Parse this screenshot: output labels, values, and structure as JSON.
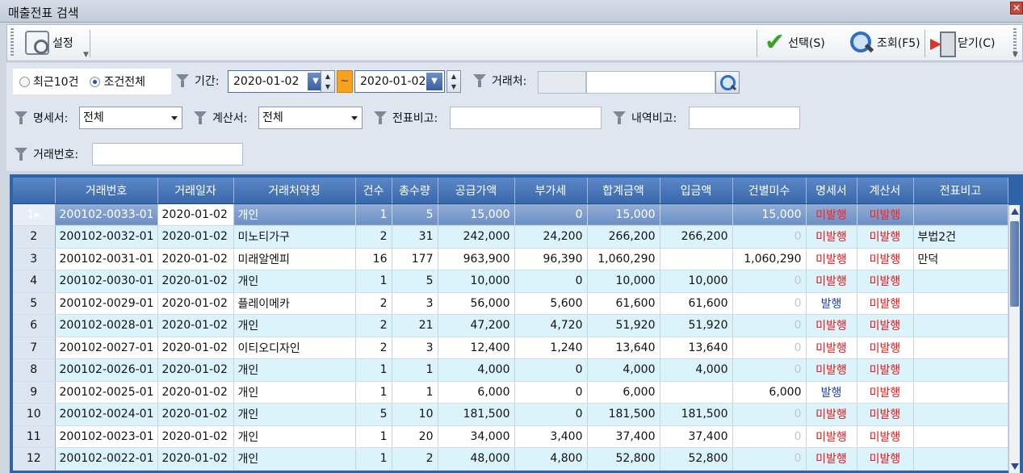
{
  "window": {
    "title": "매출전표 검색",
    "close_glyph": "✕"
  },
  "toolbar": {
    "settings_label": "설정",
    "select_label": "선택(S)",
    "query_label": "조회(F5)",
    "close_label": "닫기(C)"
  },
  "filter": {
    "radio_recent": "최근10건",
    "radio_all": "조건전체",
    "selected_radio": "조건전체",
    "period_label": "기간:",
    "date_from": "2020-01-02",
    "date_to": "2020-01-02",
    "range_sep": "~",
    "client_label": "거래처:",
    "client_code": "",
    "client_name": "",
    "statement_label": "명세서:",
    "statement_value": "전체",
    "invoice_label": "계산서:",
    "invoice_value": "전체",
    "slip_note_label": "전표비고:",
    "slip_note_value": "",
    "detail_note_label": "내역비고:",
    "detail_note_value": "",
    "trade_no_label": "거래번호:",
    "trade_no_value": ""
  },
  "grid": {
    "columns": [
      "거래번호",
      "거래일자",
      "거래처약칭",
      "건수",
      "총수량",
      "공급가액",
      "부가세",
      "합계금액",
      "입금액",
      "건별미수",
      "명세서",
      "계산서",
      "전표비고"
    ],
    "selected_row": 1,
    "rows": [
      {
        "n": "1",
        "marker": "▸",
        "no": "200102-0033-01",
        "date": "2020-01-02",
        "client": "개인",
        "cnt": "1",
        "qty": "5",
        "supply": "15,000",
        "vat": "0",
        "total": "15,000",
        "paid": "",
        "due": "15,000",
        "stmt": "미발행",
        "inv": "미발행",
        "note": ""
      },
      {
        "n": "2",
        "marker": "",
        "no": "200102-0032-01",
        "date": "2020-01-02",
        "client": "미노티가구",
        "cnt": "2",
        "qty": "31",
        "supply": "242,000",
        "vat": "24,200",
        "total": "266,200",
        "paid": "266,200",
        "due": "0",
        "stmt": "미발행",
        "inv": "미발행",
        "note": "부법2건"
      },
      {
        "n": "3",
        "marker": "",
        "no": "200102-0031-01",
        "date": "2020-01-02",
        "client": "미래알엔피",
        "cnt": "16",
        "qty": "177",
        "supply": "963,900",
        "vat": "96,390",
        "total": "1,060,290",
        "paid": "",
        "due": "1,060,290",
        "stmt": "미발행",
        "inv": "미발행",
        "note": "만덕"
      },
      {
        "n": "4",
        "marker": "",
        "no": "200102-0030-01",
        "date": "2020-01-02",
        "client": "개인",
        "cnt": "1",
        "qty": "5",
        "supply": "10,000",
        "vat": "0",
        "total": "10,000",
        "paid": "10,000",
        "due": "0",
        "stmt": "미발행",
        "inv": "미발행",
        "note": ""
      },
      {
        "n": "5",
        "marker": "",
        "no": "200102-0029-01",
        "date": "2020-01-02",
        "client": "플레이메카",
        "cnt": "2",
        "qty": "3",
        "supply": "56,000",
        "vat": "5,600",
        "total": "61,600",
        "paid": "61,600",
        "due": "0",
        "stmt": "발행",
        "inv": "미발행",
        "note": ""
      },
      {
        "n": "6",
        "marker": "",
        "no": "200102-0028-01",
        "date": "2020-01-02",
        "client": "개인",
        "cnt": "2",
        "qty": "21",
        "supply": "47,200",
        "vat": "4,720",
        "total": "51,920",
        "paid": "51,920",
        "due": "0",
        "stmt": "미발행",
        "inv": "미발행",
        "note": ""
      },
      {
        "n": "7",
        "marker": "",
        "no": "200102-0027-01",
        "date": "2020-01-02",
        "client": "이티오디자인",
        "cnt": "2",
        "qty": "3",
        "supply": "12,400",
        "vat": "1,240",
        "total": "13,640",
        "paid": "13,640",
        "due": "0",
        "stmt": "미발행",
        "inv": "미발행",
        "note": ""
      },
      {
        "n": "8",
        "marker": "",
        "no": "200102-0026-01",
        "date": "2020-01-02",
        "client": "개인",
        "cnt": "1",
        "qty": "1",
        "supply": "4,000",
        "vat": "0",
        "total": "4,000",
        "paid": "4,000",
        "due": "0",
        "stmt": "미발행",
        "inv": "미발행",
        "note": ""
      },
      {
        "n": "9",
        "marker": "",
        "no": "200102-0025-01",
        "date": "2020-01-02",
        "client": "개인",
        "cnt": "1",
        "qty": "1",
        "supply": "6,000",
        "vat": "0",
        "total": "6,000",
        "paid": "",
        "due": "6,000",
        "stmt": "발행",
        "inv": "미발행",
        "note": ""
      },
      {
        "n": "10",
        "marker": "",
        "no": "200102-0024-01",
        "date": "2020-01-02",
        "client": "개인",
        "cnt": "5",
        "qty": "10",
        "supply": "181,500",
        "vat": "0",
        "total": "181,500",
        "paid": "181,500",
        "due": "0",
        "stmt": "미발행",
        "inv": "미발행",
        "note": ""
      },
      {
        "n": "11",
        "marker": "",
        "no": "200102-0023-01",
        "date": "2020-01-02",
        "client": "개인",
        "cnt": "1",
        "qty": "20",
        "supply": "34,000",
        "vat": "3,400",
        "total": "37,400",
        "paid": "37,400",
        "due": "0",
        "stmt": "미발행",
        "inv": "미발행",
        "note": ""
      },
      {
        "n": "12",
        "marker": "",
        "no": "200102-0022-01",
        "date": "2020-01-02",
        "client": "개인",
        "cnt": "1",
        "qty": "2",
        "supply": "48,000",
        "vat": "4,800",
        "total": "52,800",
        "paid": "52,800",
        "due": "0",
        "stmt": "미발행",
        "inv": "미발행",
        "note": ""
      }
    ]
  },
  "colors": {
    "issued": "#1c3fa8",
    "unissued": "#e01818",
    "header": "#3868ac",
    "alt_row": "#dbf3fb"
  }
}
